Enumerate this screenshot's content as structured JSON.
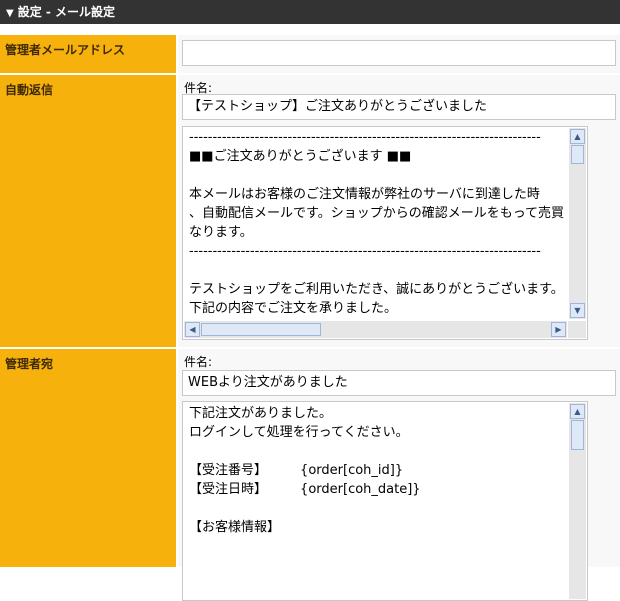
{
  "header": {
    "icon": "down-triangle-icon",
    "title": "設定 - メール設定"
  },
  "admin_email": {
    "label": "管理者メールアドレス",
    "value": ""
  },
  "auto_reply": {
    "label": "自動返信",
    "subject_label": "件名:",
    "subject": "【テストショップ】ご注文ありがとうございました",
    "body_lines": [
      "---------------------------------------------------------------------------",
      "■■ご注文ありがとうございます ■■",
      "",
      "本メールはお客様のご注文情報が弊社のサーバに到達した時",
      "、自動配信メールです。ショップからの確認メールをもって売買",
      "なります。",
      "---------------------------------------------------------------------------",
      "",
      "テストショップをご利用いただき、誠にありがとうございます。",
      "下記の内容でご注文を承りました。"
    ]
  },
  "admin_notify": {
    "label": "管理者宛",
    "subject_label": "件名:",
    "subject": "WEBより注文がありました",
    "body_lines": [
      "下記注文がありました。",
      "ログインして処理を行ってください。",
      "",
      "【受注番号】        {order[coh_id]}",
      "【受注日時】        {order[coh_date]}",
      "",
      "【お客様情報】"
    ]
  },
  "colors": {
    "header_bg": "#333333",
    "label_bg": "#f6b10c",
    "content_bg": "#f8f8f8"
  }
}
